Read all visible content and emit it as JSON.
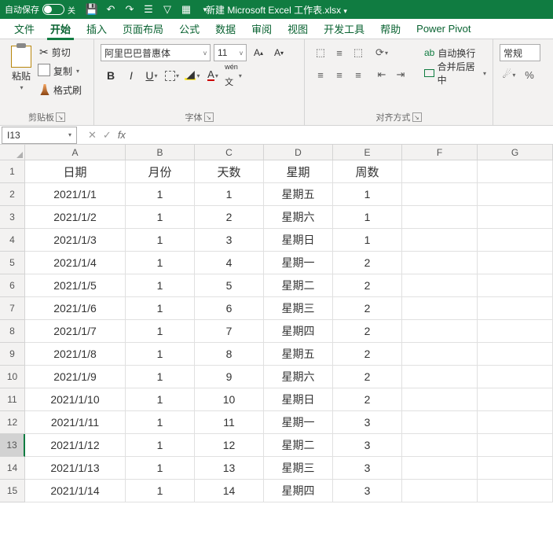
{
  "titlebar": {
    "autosave_label": "自动保存",
    "autosave_state": "关",
    "filename": "新建 Microsoft Excel 工作表.xlsx"
  },
  "tabs": [
    "文件",
    "开始",
    "插入",
    "页面布局",
    "公式",
    "数据",
    "审阅",
    "视图",
    "开发工具",
    "帮助",
    "Power Pivot"
  ],
  "active_tab": "开始",
  "ribbon": {
    "clipboard": {
      "paste": "粘贴",
      "cut": "剪切",
      "copy": "复制",
      "format_painter": "格式刷",
      "group": "剪贴板"
    },
    "font": {
      "name": "阿里巴巴普惠体",
      "size": "11",
      "group": "字体"
    },
    "align": {
      "wrap": "自动换行",
      "merge": "合并后居中",
      "group": "对齐方式"
    },
    "number": {
      "format": "常规"
    }
  },
  "namebox": "I13",
  "columns": [
    "A",
    "B",
    "C",
    "D",
    "E",
    "F",
    "G"
  ],
  "headers": [
    "日期",
    "月份",
    "天数",
    "星期",
    "周数"
  ],
  "chart_data": {
    "type": "table",
    "columns": [
      "日期",
      "月份",
      "天数",
      "星期",
      "周数"
    ],
    "rows": [
      [
        "2021/1/1",
        "1",
        "1",
        "星期五",
        "1"
      ],
      [
        "2021/1/2",
        "1",
        "2",
        "星期六",
        "1"
      ],
      [
        "2021/1/3",
        "1",
        "3",
        "星期日",
        "1"
      ],
      [
        "2021/1/4",
        "1",
        "4",
        "星期一",
        "2"
      ],
      [
        "2021/1/5",
        "1",
        "5",
        "星期二",
        "2"
      ],
      [
        "2021/1/6",
        "1",
        "6",
        "星期三",
        "2"
      ],
      [
        "2021/1/7",
        "1",
        "7",
        "星期四",
        "2"
      ],
      [
        "2021/1/8",
        "1",
        "8",
        "星期五",
        "2"
      ],
      [
        "2021/1/9",
        "1",
        "9",
        "星期六",
        "2"
      ],
      [
        "2021/1/10",
        "1",
        "10",
        "星期日",
        "2"
      ],
      [
        "2021/1/11",
        "1",
        "11",
        "星期一",
        "3"
      ],
      [
        "2021/1/12",
        "1",
        "12",
        "星期二",
        "3"
      ],
      [
        "2021/1/13",
        "1",
        "13",
        "星期三",
        "3"
      ],
      [
        "2021/1/14",
        "1",
        "14",
        "星期四",
        "3"
      ]
    ]
  },
  "selected_row": 13
}
